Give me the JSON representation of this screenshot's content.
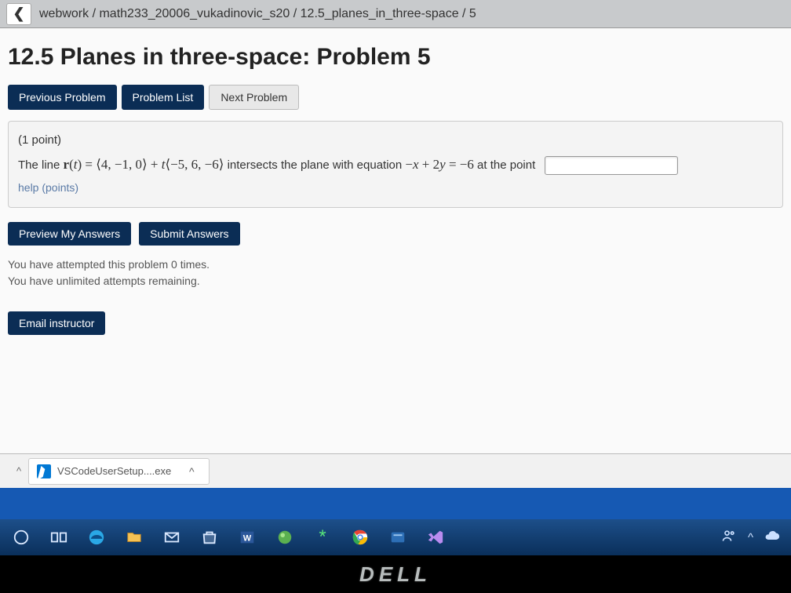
{
  "breadcrumb": "webwork / math233_20006_vukadinovic_s20 / 12.5_planes_in_three-space / 5",
  "title": "12.5 Planes in three-space: Problem 5",
  "nav": {
    "prev": "Previous Problem",
    "list": "Problem List",
    "next": "Next Problem"
  },
  "problem": {
    "points": "(1 point)",
    "text_pre": "The line ",
    "math_r": "r(t) = ⟨4, −1, 0⟩ + t⟨−5, 6, −6⟩",
    "text_mid": " intersects the plane with equation ",
    "math_eq": "−x + 2y = −6",
    "text_post": " at the point",
    "help": "help (points)"
  },
  "actions": {
    "preview": "Preview My Answers",
    "submit": "Submit Answers"
  },
  "status": {
    "line1": "You have attempted this problem 0 times.",
    "line2": "You have unlimited attempts remaining."
  },
  "email": "Email instructor",
  "download": {
    "filename": "VSCodeUserSetup....exe"
  },
  "dell": "DELL"
}
